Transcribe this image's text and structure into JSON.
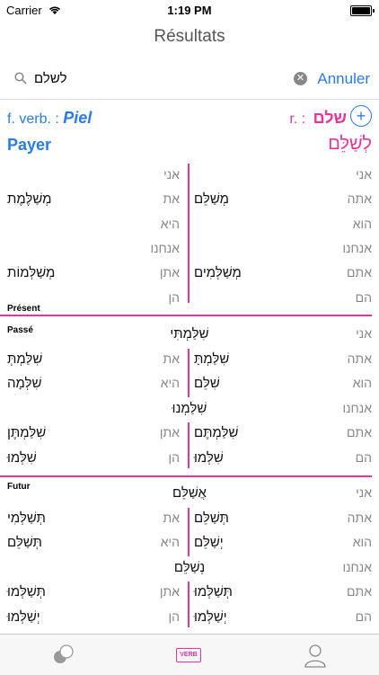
{
  "status": {
    "carrier": "Carrier",
    "time": "1:19 PM"
  },
  "nav": {
    "title": "Résultats"
  },
  "search": {
    "query": "לשלם",
    "cancel": "Annuler"
  },
  "form": {
    "prefix": "f. verb. :",
    "binyan": "Piel",
    "root_label": "r. :",
    "root": "שלם"
  },
  "translation": "Payer",
  "infinitive": "לְשַׁלֵּם",
  "present": {
    "label": "Présent",
    "rows": [
      {
        "rp": "אני",
        "rv": "",
        "lp": "אני",
        "lv": ""
      },
      {
        "rp": "אתה",
        "rv": "מְשַׁלֵּם",
        "lp": "את",
        "lv": "מְשַׁלֶּמֶת"
      },
      {
        "rp": "הוא",
        "rv": "",
        "lp": "היא",
        "lv": ""
      },
      {
        "rp": "אנחנו",
        "rv": "",
        "lp": "אנחנו",
        "lv": ""
      },
      {
        "rp": "אתם",
        "rv": "מְשַׁלְּמִים",
        "lp": "אתן",
        "lv": "מְשַׁלְּמוֹת"
      },
      {
        "rp": "הם",
        "rv": "",
        "lp": "הן",
        "lv": ""
      }
    ]
  },
  "past": {
    "label": "Passé",
    "rows": [
      {
        "type": "center",
        "p": "אני",
        "v": "שִׁלַּמְתִּי"
      },
      {
        "type": "split",
        "rp": "אתה",
        "rv": "שִׁלַּמְתָּ",
        "lp": "את",
        "lv": "שִׁלַּמְתְּ"
      },
      {
        "type": "split",
        "rp": "הוא",
        "rv": "שִׁלֵּם",
        "lp": "היא",
        "lv": "שִׁלְּמָה"
      },
      {
        "type": "center",
        "p": "אנחנו",
        "v": "שִׁלַּמְנוּ"
      },
      {
        "type": "split",
        "rp": "אתם",
        "rv": "שִׁלַּמְתֶּם",
        "lp": "אתן",
        "lv": "שִׁלַּמְתֶּן"
      },
      {
        "type": "split",
        "rp": "הם",
        "rv": "שִׁלְּמוּ",
        "lp": "הן",
        "lv": "שִׁלְּמוּ"
      }
    ]
  },
  "future": {
    "label": "Futur",
    "rows": [
      {
        "type": "center",
        "p": "אני",
        "v": "אֲשַׁלֵּם"
      },
      {
        "type": "split",
        "rp": "אתה",
        "rv": "תְּשַׁלֵּם",
        "lp": "את",
        "lv": "תְּשַׁלְּמִי"
      },
      {
        "type": "split",
        "rp": "הוא",
        "rv": "יְשַׁלֵּם",
        "lp": "היא",
        "lv": "תְּשַׁלֵּם"
      },
      {
        "type": "center",
        "p": "אנחנו",
        "v": "נְשַׁלֵּם"
      },
      {
        "type": "split",
        "rp": "אתם",
        "rv": "תְּשַׁלְּמוּ",
        "lp": "אתן",
        "lv": "תְּשַׁלְּמוּ"
      },
      {
        "type": "split",
        "rp": "הם",
        "rv": "יְשַׁלְּמוּ",
        "lp": "הן",
        "lv": "יְשַׁלְּמוּ"
      }
    ]
  },
  "tabs": {
    "verb_badge": "VERB"
  },
  "colors": {
    "accent": "#2b7be4",
    "highlight": "#e6359e"
  }
}
